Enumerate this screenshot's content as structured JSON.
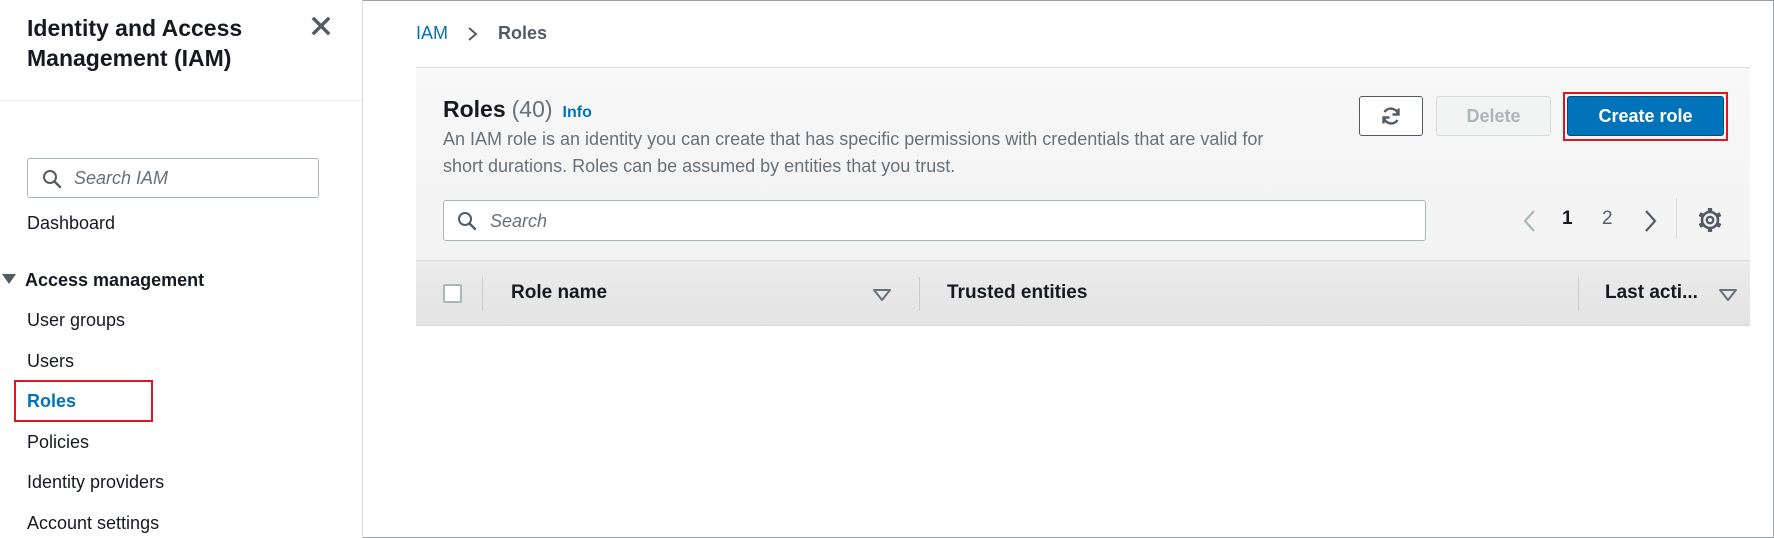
{
  "sidebar": {
    "title": "Identity and Access Management (IAM)",
    "search_placeholder": "Search IAM",
    "dashboard": "Dashboard",
    "section": "Access management",
    "items": [
      {
        "label": "User groups"
      },
      {
        "label": "Users"
      },
      {
        "label": "Roles"
      },
      {
        "label": "Policies"
      },
      {
        "label": "Identity providers"
      },
      {
        "label": "Account settings"
      }
    ]
  },
  "breadcrumb": {
    "root": "IAM",
    "current": "Roles"
  },
  "panel": {
    "title": "Roles",
    "count": "(40)",
    "info": "Info",
    "description": "An IAM role is an identity you can create that has specific permissions with credentials that are valid for short durations. Roles can be assumed by entities that you trust.",
    "delete_label": "Delete",
    "create_label": "Create role",
    "search_placeholder": "Search",
    "pages": [
      "1",
      "2"
    ],
    "columns": [
      "Role name",
      "Trusted entities",
      "Last acti..."
    ]
  },
  "colors": {
    "link": "#0073bb",
    "primary_button": "#0073bb",
    "highlight": "#e0161e"
  },
  "icons": {
    "close": "close-icon",
    "search": "search-icon",
    "refresh": "refresh-icon",
    "settings": "gear-icon"
  }
}
